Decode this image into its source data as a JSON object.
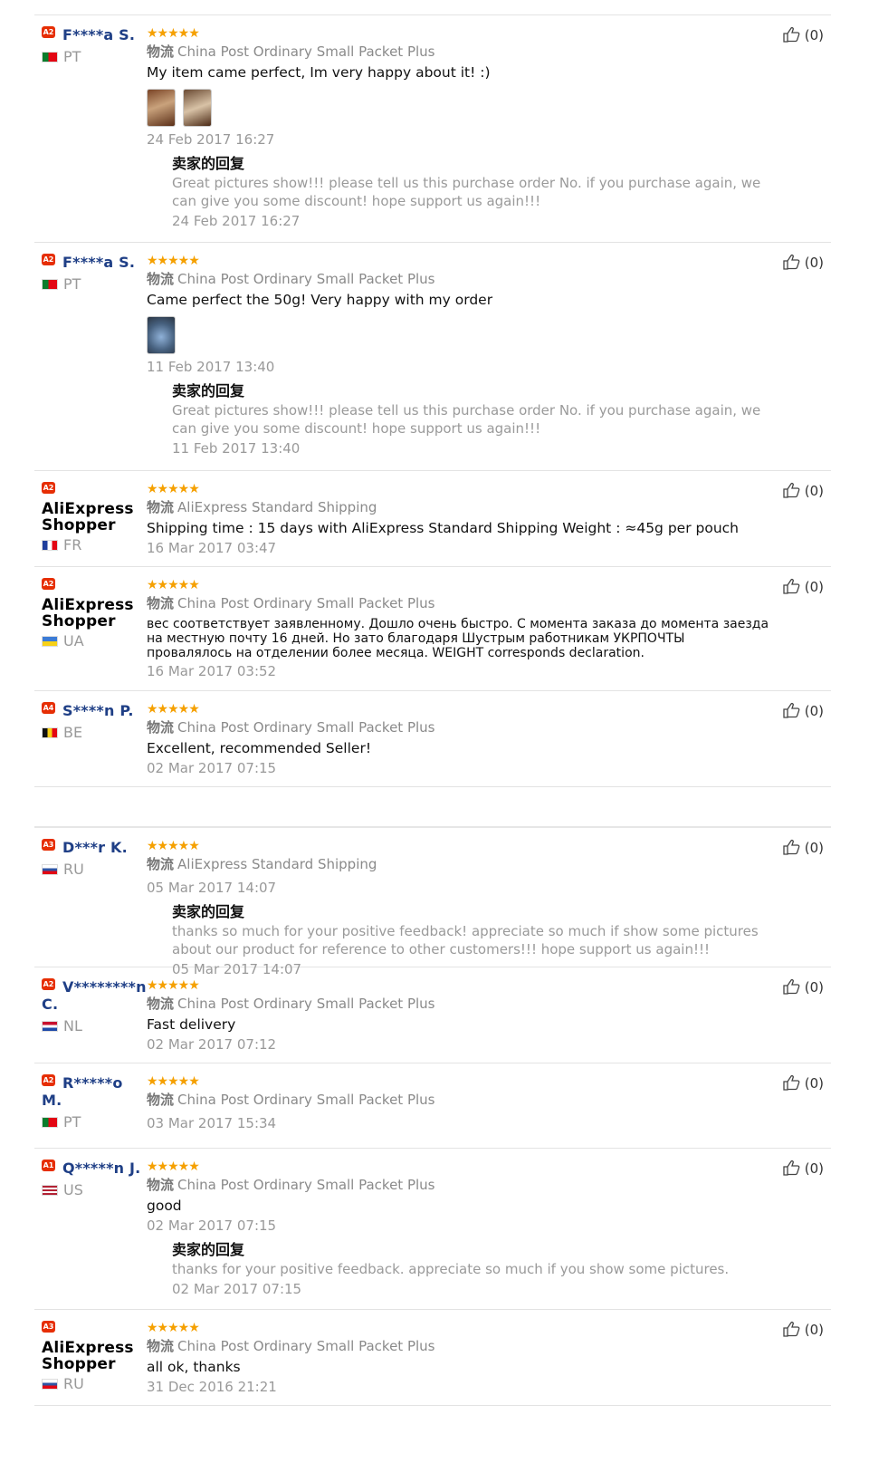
{
  "labels": {
    "logistics": "物流",
    "seller_reply_title": "卖家的回复",
    "star_glyphs": "★★★★★"
  },
  "reviews": [
    {
      "level": "A2",
      "name": "F****a S.",
      "country": "PT",
      "rating": 5,
      "shipping": "China Post Ordinary Small Packet Plus",
      "text": "My item came perfect, Im very happy about it! :)",
      "photos": 2,
      "date": "24 Feb 2017 16:27",
      "reply": {
        "text": "Great pictures show!!! please tell us this purchase order No. if you purchase again, we can give you some discount! hope support us again!!!",
        "date": "24 Feb 2017 16:27"
      },
      "likes": "(0)"
    },
    {
      "level": "A2",
      "name": "F****a S.",
      "country": "PT",
      "rating": 5,
      "shipping": "China Post Ordinary Small Packet Plus",
      "text": "Came perfect the 50g! Very happy with my order",
      "photos": 1,
      "date": "11 Feb 2017 13:40",
      "reply": {
        "text": "Great pictures show!!! please tell us this purchase order No. if you purchase again, we can give you some discount! hope support us again!!!",
        "date": "11 Feb 2017 13:40"
      },
      "likes": "(0)"
    },
    {
      "level": "A2",
      "name": "AliExpress Shopper",
      "country": "FR",
      "rating": 5,
      "shipping": "AliExpress Standard Shipping",
      "text": "Shipping time : 15 days with AliExpress Standard Shipping Weight : ≈45g per pouch",
      "date": "16 Mar 2017 03:47",
      "likes": "(0)"
    },
    {
      "level": "A2",
      "name": "AliExpress Shopper",
      "country": "UA",
      "rating": 5,
      "shipping": "China Post Ordinary Small Packet Plus",
      "text": "вес соответствует заявленному. Дошло очень быстро. С момента заказа до момента заезда на местную почту 16 дней. Но зато благодаря Шустрым работникам УКРПОЧТЫ провалялось на отделении более месяца. WEIGHT corresponds declaration.",
      "date": "16 Mar 2017 03:52",
      "likes": "(0)"
    },
    {
      "level": "A4",
      "name": "S****n P.",
      "country": "BE",
      "rating": 5,
      "shipping": "China Post Ordinary Small Packet Plus",
      "text": "Excellent, recommended Seller!",
      "date": "02 Mar 2017 07:15",
      "likes": "(0)"
    },
    {
      "level": "A3",
      "name": "D***r K.",
      "country": "RU",
      "rating": 5,
      "shipping": "AliExpress Standard Shipping",
      "text": "",
      "date": "05 Mar 2017 14:07",
      "reply": {
        "text": "thanks so much for your positive feedback! appreciate so much if show some pictures about our product for reference to other customers!!! hope support us again!!!",
        "date": "05 Mar 2017 14:07"
      },
      "likes": "(0)"
    },
    {
      "level": "A2",
      "name": "V********n C.",
      "country": "NL",
      "rating": 5,
      "shipping": "China Post Ordinary Small Packet Plus",
      "text": "Fast delivery",
      "date": "02 Mar 2017 07:12",
      "likes": "(0)"
    },
    {
      "level": "A2",
      "name": "R*****o M.",
      "country": "PT",
      "rating": 5,
      "shipping": "China Post Ordinary Small Packet Plus",
      "text": "",
      "date": "03 Mar 2017 15:34",
      "likes": "(0)"
    },
    {
      "level": "A1",
      "name": "Q*****n J.",
      "country": "US",
      "rating": 5,
      "shipping": "China Post Ordinary Small Packet Plus",
      "text": "good",
      "date": "02 Mar 2017 07:15",
      "reply": {
        "text": "thanks for your positive feedback. appreciate so much if you show some pictures.",
        "date": "02 Mar 2017 07:15"
      },
      "likes": "(0)"
    },
    {
      "level": "A3",
      "name": "AliExpress Shopper",
      "country": "RU",
      "rating": 5,
      "shipping": "China Post Ordinary Small Packet Plus",
      "text": "all ok, thanks",
      "date": "31 Dec 2016 21:21",
      "likes": "(0)"
    }
  ],
  "flag_colors": {
    "PT": [
      "#0a7d2c",
      "#e30613"
    ],
    "FR": [
      "#1f3f9c",
      "#ffffff",
      "#e30613"
    ],
    "UA": [
      "#3b7bd6",
      "#f7d117"
    ],
    "BE": [
      "#111111",
      "#f7d117",
      "#e30613"
    ],
    "RU": [
      "#ffffff",
      "#2f55a4",
      "#e30613"
    ],
    "NL": [
      "#c8102e",
      "#ffffff",
      "#1e4aa8"
    ],
    "US": [
      "#b22234",
      "#ffffff",
      "#3c3b6e"
    ]
  }
}
